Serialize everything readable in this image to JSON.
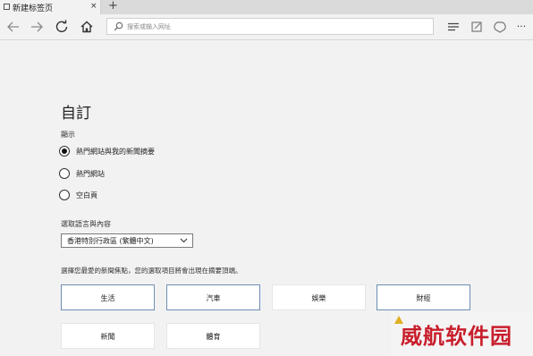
{
  "tab": {
    "title": "新建标签页",
    "close_glyph": "×",
    "new_tab_glyph": "+"
  },
  "toolbar": {
    "back_icon": "back-arrow-icon",
    "forward_icon": "forward-arrow-icon",
    "refresh_icon": "refresh-icon",
    "home_icon": "home-icon",
    "hub_icon": "hub-icon",
    "note_icon": "web-note-icon",
    "share_icon": "share-icon",
    "more_glyph": "···"
  },
  "search": {
    "placeholder": "搜索或输入网址",
    "value": ""
  },
  "customize": {
    "heading": "自訂",
    "show_label": "顯示",
    "options": [
      {
        "label": "熱門網站與我的新聞摘要",
        "checked": true
      },
      {
        "label": "熱門網站",
        "checked": false
      },
      {
        "label": "空白頁",
        "checked": false
      }
    ],
    "language_label": "選取語言與內容",
    "language_value": "香港特別行政區 (繁體中文)",
    "interests_prompt": "選擇您最愛的新聞焦點，您的選取項目將會出現在摘要頂端。",
    "topics": [
      {
        "label": "生活",
        "selected": true
      },
      {
        "label": "汽車",
        "selected": true
      },
      {
        "label": "娛樂",
        "selected": false
      },
      {
        "label": "財經",
        "selected": true
      },
      {
        "label": "新聞",
        "selected": false
      },
      {
        "label": "體育",
        "selected": false
      }
    ]
  },
  "watermark": {
    "text": "威航软件园"
  },
  "colors": {
    "background": "#f2f2f2",
    "tile_border_selected": "#6d8fb3",
    "watermark": "#c81e2c"
  }
}
